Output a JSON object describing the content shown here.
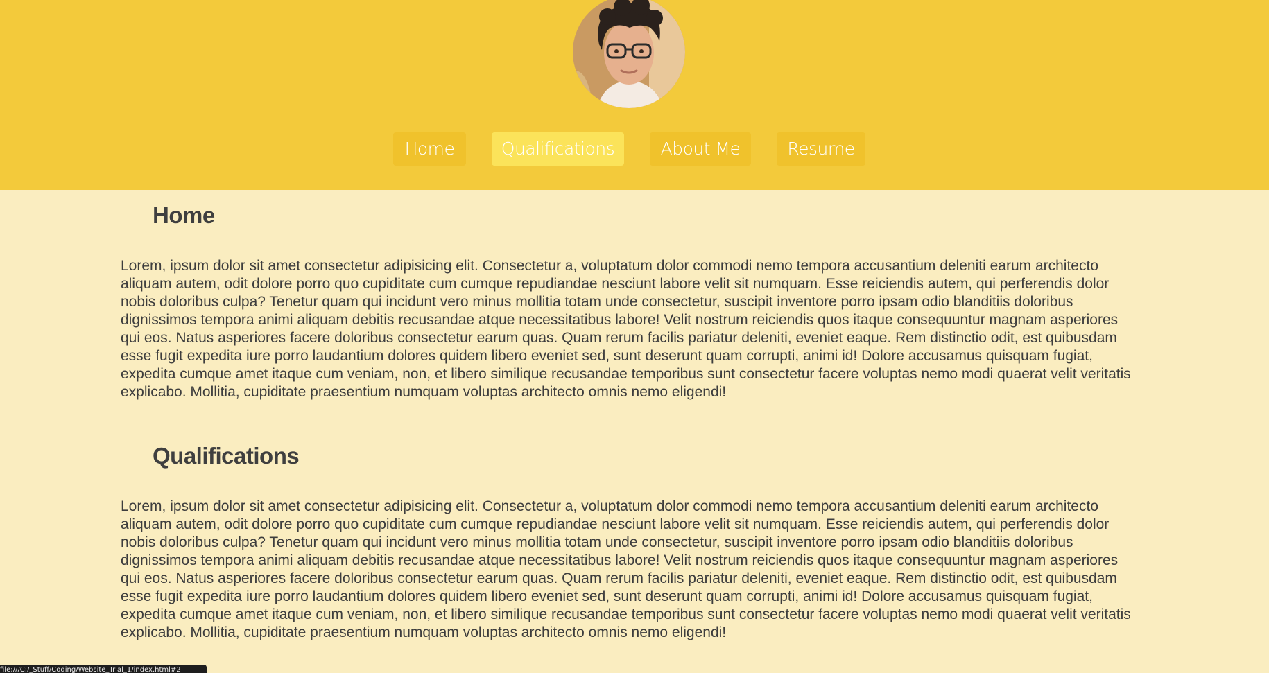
{
  "header": {
    "avatar_alt": "Profile photo",
    "nav": [
      {
        "label": "Home",
        "active": false
      },
      {
        "label": "Qualifications",
        "active": true
      },
      {
        "label": "About Me",
        "active": false
      },
      {
        "label": "Resume",
        "active": false
      }
    ]
  },
  "sections": [
    {
      "title": "Home",
      "body": "Lorem, ipsum dolor sit amet consectetur adipisicing elit. Consectetur a, voluptatum dolor commodi nemo tempora accusantium deleniti earum architecto aliquam autem, odit dolore porro quo cupiditate cum cumque repudiandae nesciunt labore velit sit numquam. Esse reiciendis autem, qui perferendis dolor nobis doloribus culpa? Tenetur quam qui incidunt vero minus mollitia totam unde consectetur, suscipit inventore porro ipsam odio blanditiis doloribus dignissimos tempora animi aliquam debitis recusandae atque necessitatibus labore! Velit nostrum reiciendis quos itaque consequuntur magnam asperiores qui eos. Natus asperiores facere doloribus consectetur earum quas. Quam rerum facilis pariatur deleniti, eveniet eaque. Rem distinctio odit, est quibusdam esse fugit expedita iure porro laudantium dolores quidem libero eveniet sed, sunt deserunt quam corrupti, animi id! Dolore accusamus quisquam fugiat, expedita cumque amet itaque cum veniam, non, et libero similique recusandae temporibus sunt consectetur facere voluptas nemo modi quaerat velit veritatis explicabo. Mollitia, cupiditate praesentium numquam voluptas architecto omnis nemo eligendi!"
    },
    {
      "title": "Qualifications",
      "body": "Lorem, ipsum dolor sit amet consectetur adipisicing elit. Consectetur a, voluptatum dolor commodi nemo tempora accusantium deleniti earum architecto aliquam autem, odit dolore porro quo cupiditate cum cumque repudiandae nesciunt labore velit sit numquam. Esse reiciendis autem, qui perferendis dolor nobis doloribus culpa? Tenetur quam qui incidunt vero minus mollitia totam unde consectetur, suscipit inventore porro ipsam odio blanditiis doloribus dignissimos tempora animi aliquam debitis recusandae atque necessitatibus labore! Velit nostrum reiciendis quos itaque consequuntur magnam asperiores qui eos. Natus asperiores facere doloribus consectetur earum quas. Quam rerum facilis pariatur deleniti, eveniet eaque. Rem distinctio odit, est quibusdam esse fugit expedita iure porro laudantium dolores quidem libero eveniet sed, sunt deserunt quam corrupti, animi id! Dolore accusamus quisquam fugiat, expedita cumque amet itaque cum veniam, non, et libero similique recusandae temporibus sunt consectetur facere voluptas nemo modi quaerat velit veritatis explicabo. Mollitia, cupiditate praesentium numquam voluptas architecto omnis nemo eligendi!"
    }
  ],
  "status_bar": {
    "url": "file:///C:/_Stuff/Coding/Website_Trial_1/index.html#2"
  },
  "colors": {
    "header_bg": "#f3ca3b",
    "page_bg": "#faedc0",
    "nav_button": "#f0c22c",
    "nav_button_active": "#fbe35a",
    "text": "#3d3d3d"
  }
}
